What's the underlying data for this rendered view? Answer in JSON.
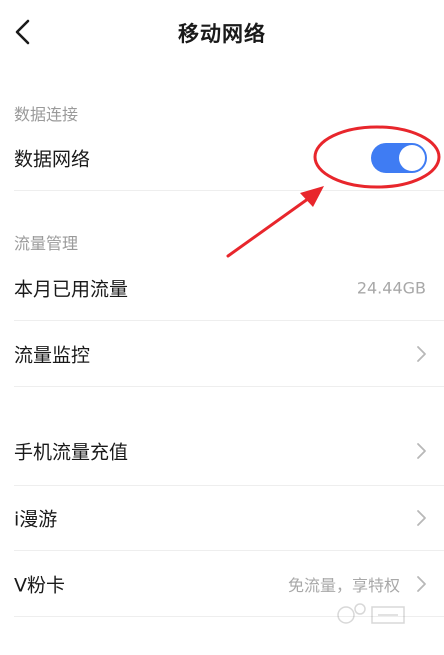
{
  "header": {
    "title": "移动网络"
  },
  "sections": {
    "data_connection": {
      "header": "数据连接",
      "data_network_label": "数据网络",
      "data_network_toggle": true
    },
    "traffic_management": {
      "header": "流量管理",
      "monthly_usage_label": "本月已用流量",
      "monthly_usage_value": "24.44GB",
      "traffic_monitor_label": "流量监控"
    },
    "other": {
      "recharge_label": "手机流量充值",
      "roaming_label": "i漫游",
      "vcard_label": "V粉卡",
      "vcard_value": "免流量，享特权"
    }
  },
  "colors": {
    "toggle_on": "#3f7cf3",
    "annotation_red": "#e8262c"
  },
  "icons": {
    "back": "chevron-left-icon",
    "chevron": "chevron-right-icon"
  }
}
